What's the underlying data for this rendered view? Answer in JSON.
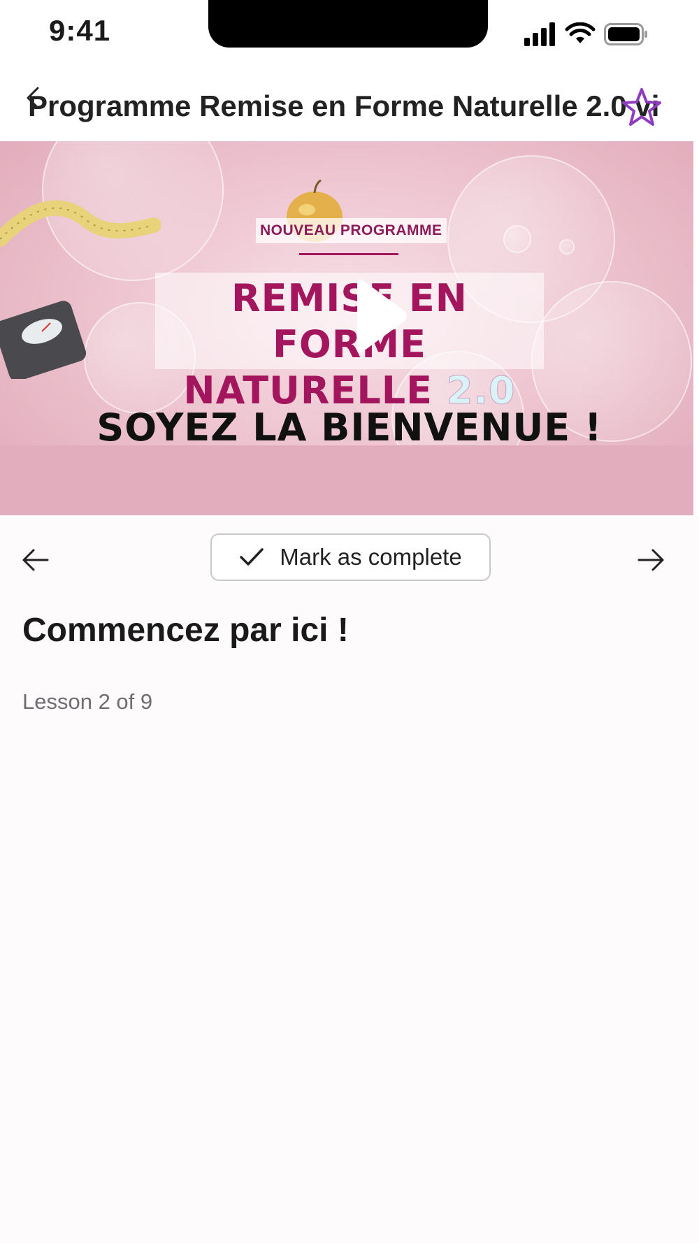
{
  "status_bar": {
    "time": "9:41",
    "icons": [
      "signal-icon",
      "wifi-icon",
      "battery-icon"
    ]
  },
  "header": {
    "title": "Programme Remise en Forme Naturelle 2.0 vi",
    "back_icon": "back-arrow-icon",
    "favorite_icon": "star-icon"
  },
  "video": {
    "badge": "NOUVEAU PROGRAMME",
    "headline_line1": "REMISE EN FORME",
    "headline_line2": "NATURELLE",
    "headline_version": "2.0",
    "welcome": "SOYEZ LA BIENVENUE !",
    "play_icon": "play-icon"
  },
  "controls": {
    "prev_icon": "arrow-left-icon",
    "next_icon": "arrow-right-icon",
    "complete_label": "Mark as complete",
    "check_icon": "check-icon"
  },
  "lesson": {
    "title": "Commencez par ici !",
    "position": "Lesson 2 of 9"
  },
  "colors": {
    "accent": "#8e3cc0",
    "headline": "#a3155c",
    "video_bg": "#eec6d1"
  }
}
